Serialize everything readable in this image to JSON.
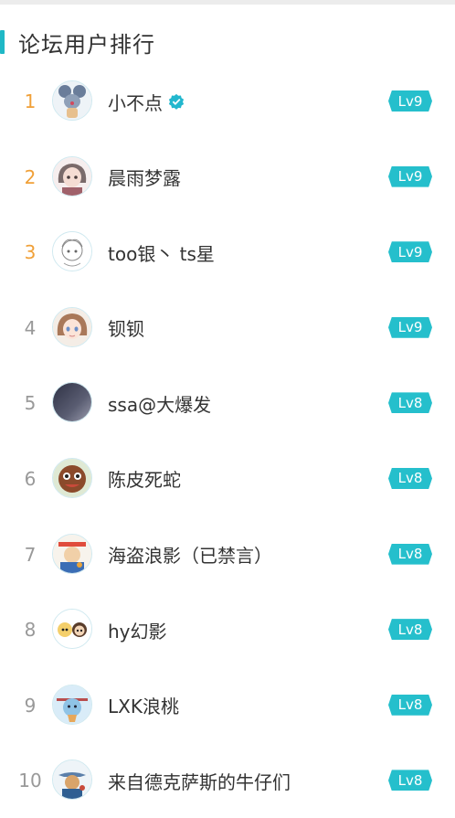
{
  "panel": {
    "title": "论坛用户排行"
  },
  "colors": {
    "accent": "#1fb8c6",
    "top_rank": "#f0a038",
    "rank": "#999999",
    "level_badge": "#25bfcc"
  },
  "users": [
    {
      "rank": "1",
      "name": "小不点",
      "level": "Lv9",
      "verified": true,
      "avatar_icon": "cartoon-mouse-avatar-icon"
    },
    {
      "rank": "2",
      "name": "晨雨梦露",
      "level": "Lv9",
      "verified": false,
      "avatar_icon": "anime-girl-avatar-icon"
    },
    {
      "rank": "3",
      "name": "too银丶 ts星",
      "level": "Lv9",
      "verified": false,
      "avatar_icon": "sketch-character-avatar-icon"
    },
    {
      "rank": "4",
      "name": "钡钡",
      "level": "Lv9",
      "verified": false,
      "avatar_icon": "anime-girl-avatar-icon"
    },
    {
      "rank": "5",
      "name": "ssa@大爆发",
      "level": "Lv8",
      "verified": false,
      "avatar_icon": "dark-gradient-avatar-icon"
    },
    {
      "rank": "6",
      "name": "陈皮死蛇",
      "level": "Lv8",
      "verified": false,
      "avatar_icon": "brown-creature-avatar-icon"
    },
    {
      "rank": "7",
      "name": "海盗浪影（已禁言）",
      "level": "Lv8",
      "verified": false,
      "avatar_icon": "pirate-avatar-icon"
    },
    {
      "rank": "8",
      "name": "hy幻影",
      "level": "Lv8",
      "verified": false,
      "avatar_icon": "cartoon-pair-avatar-icon"
    },
    {
      "rank": "9",
      "name": "LXK浪桃",
      "level": "Lv8",
      "verified": false,
      "avatar_icon": "blue-character-avatar-icon"
    },
    {
      "rank": "10",
      "name": "来自德克萨斯的牛仔们",
      "level": "Lv8",
      "verified": false,
      "avatar_icon": "cowboy-avatar-icon"
    }
  ]
}
